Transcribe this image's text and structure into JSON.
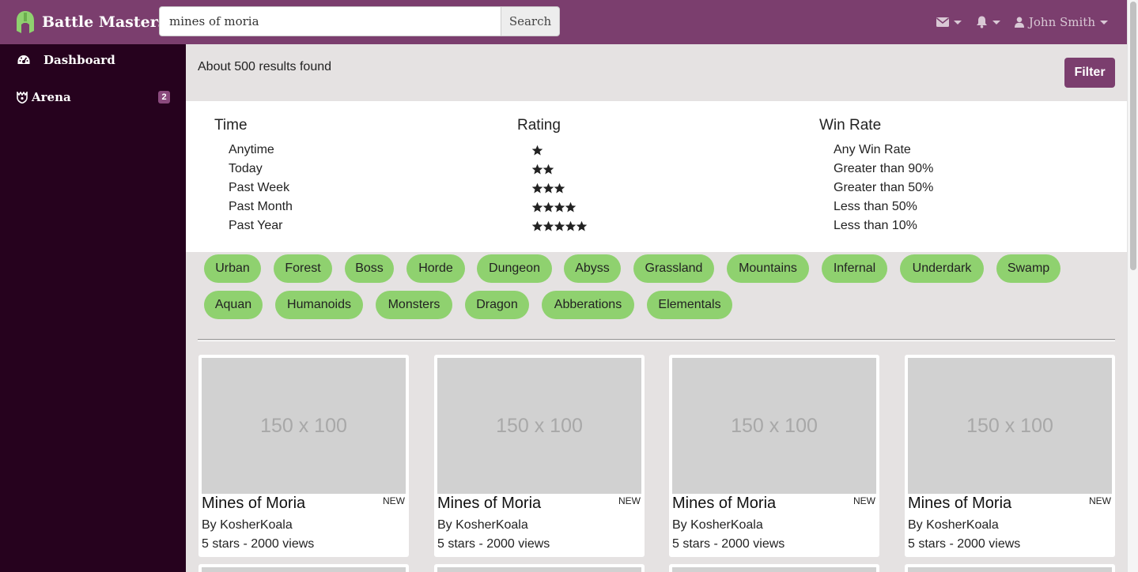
{
  "brand": {
    "name": "Battle Masters",
    "accent": "#7b3e6e",
    "logo_color": "#8fd16f"
  },
  "search": {
    "value": "mines of moria",
    "button_label": "Search"
  },
  "nav": {
    "user_name": "John Smith",
    "icons": [
      "envelope-icon",
      "bell-icon",
      "user-icon"
    ]
  },
  "sidebar": {
    "items": [
      {
        "label": "Dashboard",
        "icon": "dashboard-icon"
      },
      {
        "label": "Arena",
        "icon": "arena-icon",
        "badge": "2"
      }
    ]
  },
  "main": {
    "results_text": "About 500 results found",
    "filter_button": "Filter",
    "filters": {
      "time": {
        "title": "Time",
        "options": [
          "Anytime",
          "Today",
          "Past Week",
          "Past Month",
          "Past Year"
        ]
      },
      "rating": {
        "title": "Rating",
        "star_counts": [
          1,
          2,
          3,
          4,
          5
        ]
      },
      "win_rate": {
        "title": "Win Rate",
        "options": [
          "Any Win Rate",
          "Greater than 90%",
          "Greater than 50%",
          "Less than 50%",
          "Less than 10%"
        ]
      }
    },
    "tags": [
      "Urban",
      "Forest",
      "Boss",
      "Horde",
      "Dungeon",
      "Abyss",
      "Grassland",
      "Mountains",
      "Infernal",
      "Underdark",
      "Swamp",
      "Aquan",
      "Humanoids",
      "Monsters",
      "Dragon",
      "Abberations",
      "Elementals"
    ],
    "cards": [
      {
        "image_text": "150 x 100",
        "title": "Mines of Moria",
        "badge": "NEW",
        "author": "By KosherKoala",
        "stats": "5 stars - 2000 views"
      },
      {
        "image_text": "150 x 100",
        "title": "Mines of Moria",
        "badge": "NEW",
        "author": "By KosherKoala",
        "stats": "5 stars - 2000 views"
      },
      {
        "image_text": "150 x 100",
        "title": "Mines of Moria",
        "badge": "NEW",
        "author": "By KosherKoala",
        "stats": "5 stars - 2000 views"
      },
      {
        "image_text": "150 x 100",
        "title": "Mines of Moria",
        "badge": "NEW",
        "author": "By KosherKoala",
        "stats": "5 stars - 2000 views"
      }
    ]
  }
}
